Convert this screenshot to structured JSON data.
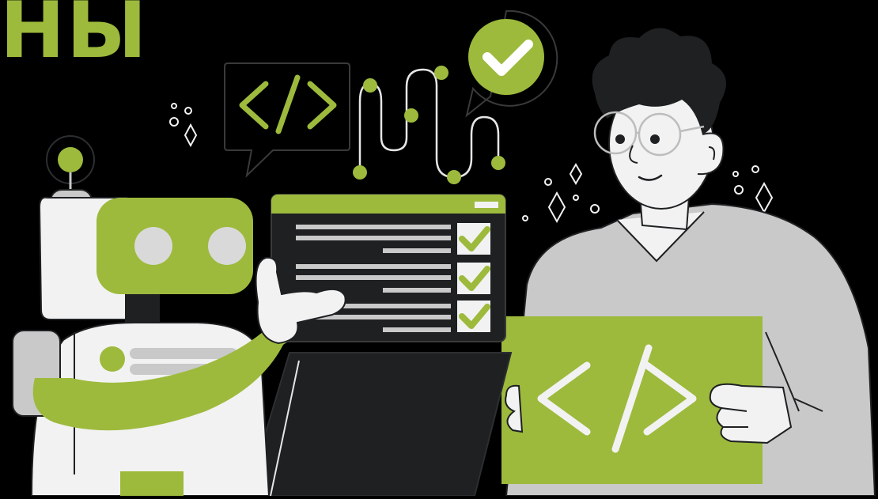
{
  "title": {
    "text": "НЫ"
  },
  "colors": {
    "background": "#000000",
    "accent": "#9dba3c",
    "ink": "#1e2022",
    "light": "#f2f2f2",
    "gray": "#c9c9c9"
  },
  "illustration": {
    "elements": [
      "code-speech-bubble",
      "flow-path-with-dots",
      "check-speech-bubble",
      "robot",
      "laptop",
      "checklist-screen",
      "developer-person",
      "code-sign"
    ]
  }
}
